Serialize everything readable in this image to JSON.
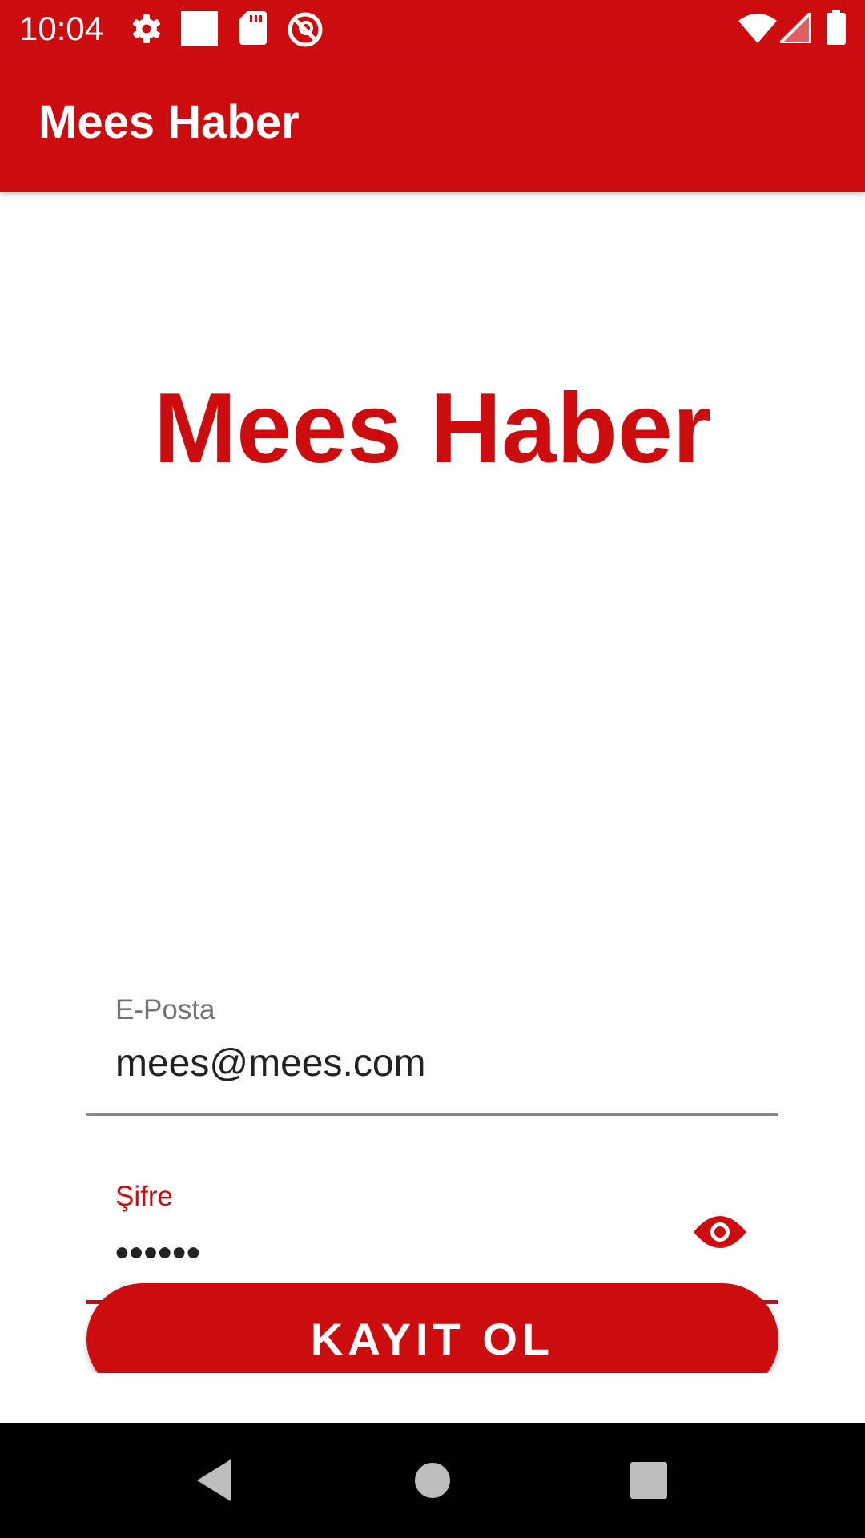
{
  "status_bar": {
    "time": "10:04",
    "icons": [
      "settings-icon",
      "square-icon",
      "sd-card-icon",
      "do-not-disturb-icon",
      "wifi-icon",
      "signal-icon",
      "battery-icon"
    ]
  },
  "app_bar": {
    "title": "Mees Haber"
  },
  "main": {
    "brand_title": "Mees Haber",
    "email_field": {
      "label": "E-Posta",
      "value": "mees@mees.com"
    },
    "password_field": {
      "label": "Şifre",
      "value": "••••••",
      "toggle_icon": "eye-icon"
    },
    "register_button": {
      "label": "KAYIT OL"
    }
  },
  "nav_bar": {
    "buttons": [
      "back-icon",
      "home-icon",
      "recents-icon"
    ]
  },
  "colors": {
    "primary": "#cc0c0f",
    "nav_background": "#000000",
    "label_gray": "#737373"
  }
}
